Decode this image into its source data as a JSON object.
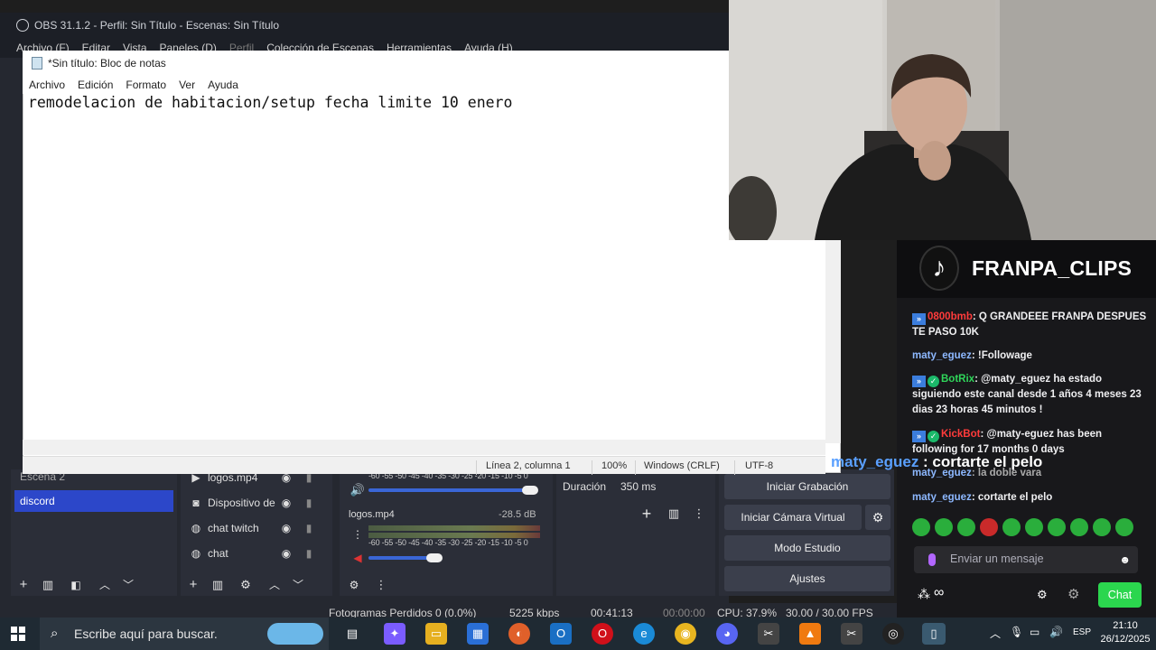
{
  "obs": {
    "title": "OBS 31.1.2 - Perfil: Sin Título - Escenas: Sin Título",
    "menu": [
      "Archivo (F)",
      "Editar",
      "Vista",
      "Paneles (D)",
      "Perfil",
      "Colección de Escenas",
      "Herramientas",
      "Ayuda (H)"
    ],
    "scenes": [
      "Escena 2",
      "discord"
    ],
    "sources": [
      {
        "name": "logos.mp4",
        "icon": "play-icon"
      },
      {
        "name": "Dispositivo de",
        "icon": "camera-icon"
      },
      {
        "name": "chat twitch",
        "icon": "globe-icon"
      },
      {
        "name": "chat",
        "icon": "globe-icon"
      }
    ],
    "mixer": {
      "scale_top": "-60 -55 -50 -45 -40 -35 -30 -25 -20 -15 -10 -5  0",
      "scale_bottom": "-60 -55 -50 -45 -40 -35 -30 -25 -20 -15 -10  -5  0",
      "track_name": "logos.mp4",
      "track_db": "-28.5 dB"
    },
    "transition": {
      "label": "Duración",
      "value": "350 ms"
    },
    "controls": [
      "Iniciar Grabación",
      "Iniciar Cámara Virtual",
      "Modo Estudio",
      "Ajustes"
    ],
    "status": {
      "dropped": "Fotogramas Perdidos 0 (0.0%)",
      "kbps": "5225 kbps",
      "time1": "00:41:13",
      "time2": "00:00:00",
      "cpu": "CPU: 37.9%",
      "fps": "30.00 / 30.00 FPS"
    }
  },
  "notepad": {
    "title": "*Sin título: Bloc de notas",
    "menu": [
      "Archivo",
      "Edición",
      "Formato",
      "Ver",
      "Ayuda"
    ],
    "text": "remodelacion de habitacion/setup fecha limite 10 enero",
    "status": {
      "position": "Línea 2, columna 1",
      "zoom": "100%",
      "eol": "Windows (CRLF)",
      "encoding": "UTF-8"
    }
  },
  "chat": {
    "brand": "FRANPA_CLIPS",
    "messages": [
      {
        "user": "0800bmb",
        "sep": ": ",
        "text": "Q GRANDEEE FRANPA DESPUES TE PASO 10K"
      },
      {
        "user": "maty_eguez",
        "sep": ": ",
        "text": "!Followage"
      },
      {
        "user": "BotRix",
        "sep": ": ",
        "text": "@maty_eguez ha estado siguiendo este canal desde 1 años 4 meses 23 dias 23 horas 45 minutos !"
      },
      {
        "user": "KickBot",
        "sep": ": ",
        "text": "@maty-eguez has been following for 17 months 0 days"
      },
      {
        "user": "maty_eguez",
        "sep": ": ",
        "text": "la doble vara"
      },
      {
        "user": "maty_eguez",
        "sep": ": ",
        "text": "cortarte el pelo"
      }
    ],
    "highlight": {
      "user": "maty_eguez",
      "text": " : cortarte el pelo"
    },
    "input_placeholder": "Enviar un mensaje",
    "chat_button": "Chat",
    "infinity": "∞"
  },
  "taskbar": {
    "search_placeholder": "Escribe aquí para buscar.",
    "lang": "ESP",
    "time": "21:10",
    "date": "26/12/2025"
  },
  "colors": {
    "obs_bg": "#252830",
    "scene_selected": "#2c47c9",
    "chat_green": "#2bd64e",
    "user_blue": "#8db8ff"
  }
}
